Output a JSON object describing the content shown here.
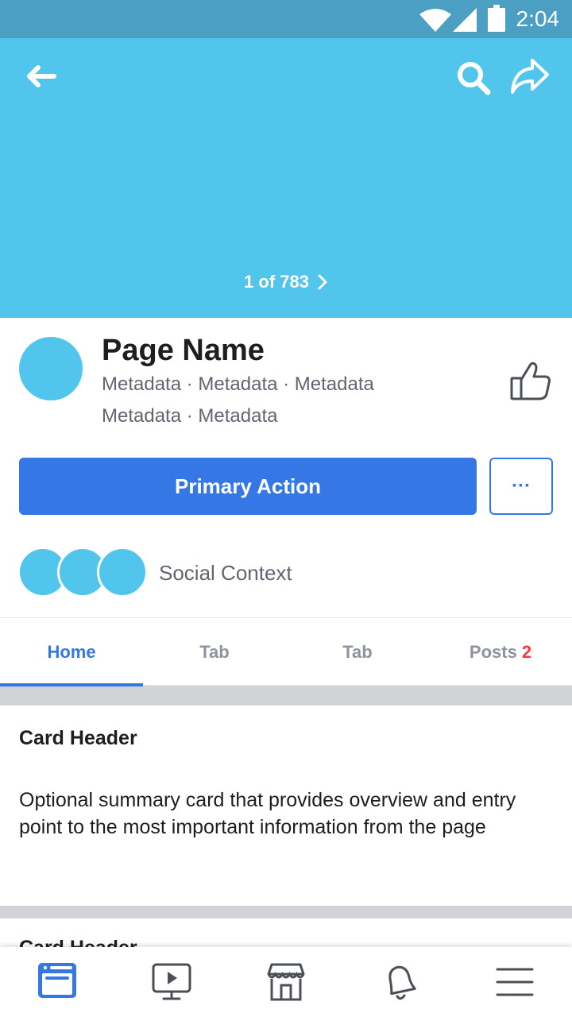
{
  "status_bar": {
    "time": "2:04",
    "icons": [
      "wifi-icon",
      "cell-signal-icon",
      "battery-icon"
    ]
  },
  "cover": {
    "photo_counter": "1 of 783",
    "icons": [
      "back-arrow-icon",
      "search-icon",
      "share-icon",
      "chevron-right-icon"
    ]
  },
  "page": {
    "name": "Page Name",
    "metadata_line_1": "Metadata · Metadata · Metadata",
    "metadata_line_2": "Metadata · Metadata",
    "like_icon": "thumbs-up-icon"
  },
  "actions": {
    "primary_label": "Primary Action",
    "more_label": "···"
  },
  "social": {
    "text": "Social Context"
  },
  "tabs": [
    {
      "label": "Home",
      "active": true
    },
    {
      "label": "Tab",
      "active": false
    },
    {
      "label": "Tab",
      "active": false
    },
    {
      "label": "Posts",
      "badge": "2",
      "active": false
    }
  ],
  "cards": [
    {
      "header": "Card Header",
      "body": "Optional summary card that provides overview and entry point to the most important information from the page"
    },
    {
      "header": "Card Header"
    }
  ],
  "bottom_nav": [
    "news-feed-icon",
    "video-icon",
    "marketplace-icon",
    "notifications-icon",
    "menu-icon"
  ],
  "colors": {
    "status_bar": "#4a9fc3",
    "cover": "#52c5ec",
    "accent": "#3578e5",
    "badge": "#fa383e",
    "secondary_text": "#606770",
    "inactive_tab": "#8d949e"
  }
}
